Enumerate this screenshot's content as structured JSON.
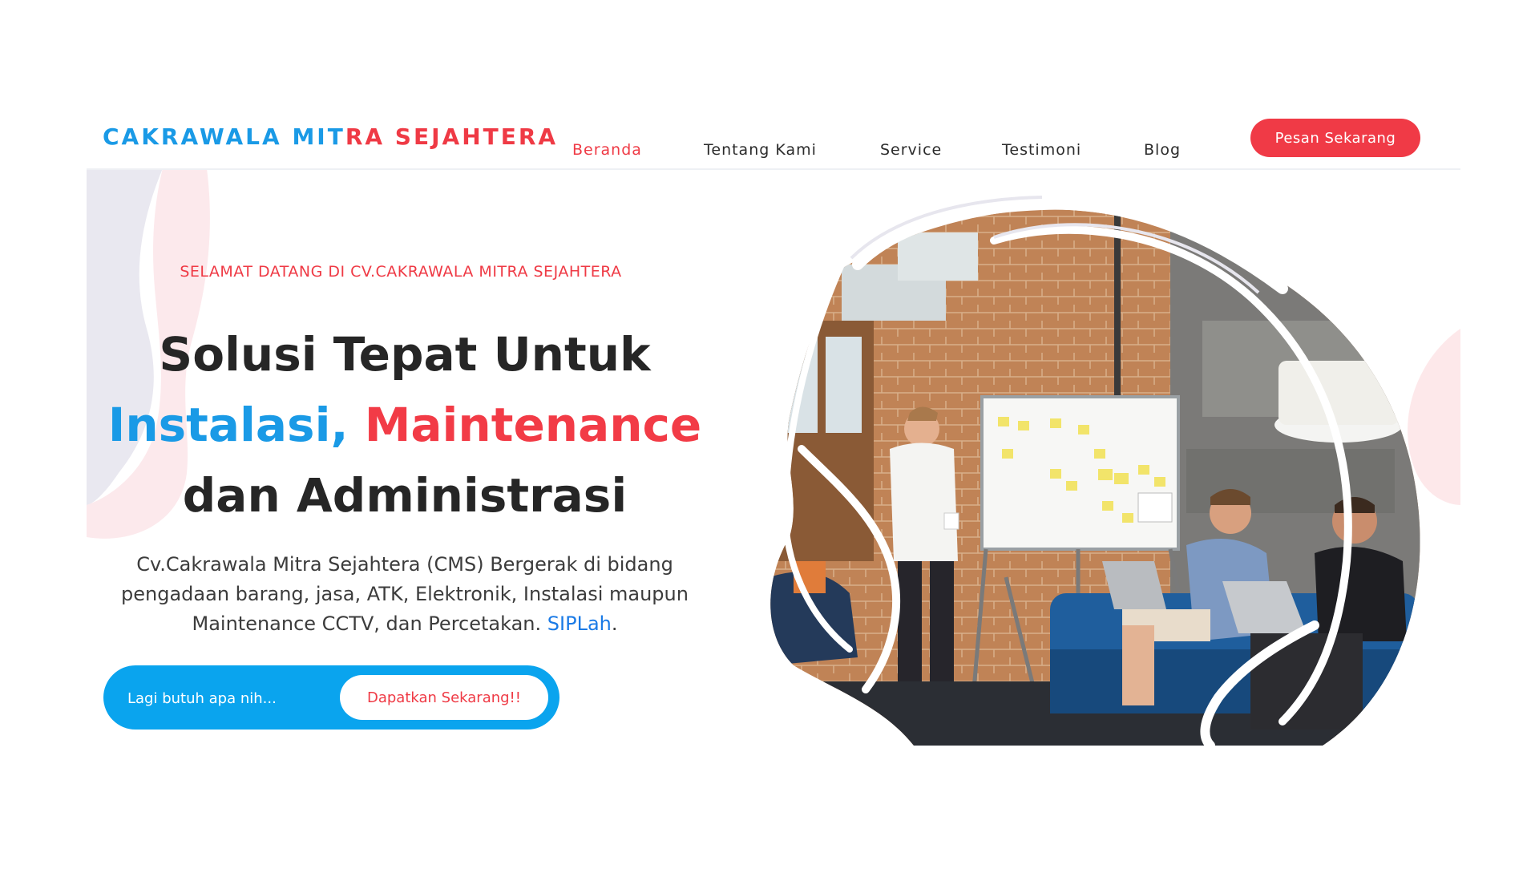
{
  "brand": {
    "logo_part1": "CAKRAWALA MIT",
    "logo_part2": "RA SEJAHTERA"
  },
  "nav": {
    "items": [
      {
        "label": "Beranda",
        "active": true
      },
      {
        "label": "Tentang Kami",
        "active": false
      },
      {
        "label": "Service",
        "active": false
      },
      {
        "label": "Testimoni",
        "active": false
      },
      {
        "label": "Blog",
        "active": false
      }
    ],
    "cta_label": "Pesan Sekarang"
  },
  "hero": {
    "welcome": "SELAMAT DATANG DI CV.CAKRAWALA MITRA SEJAHTERA",
    "headline_line1": "Solusi Tepat Untuk",
    "headline_blue": "Instalasi,",
    "headline_red": "Maintenance",
    "headline_line3": "dan Administrasi",
    "description": "Cv.Cakrawala Mitra Sejahtera (CMS) Bergerak di bidang pengadaan barang, jasa, ATK, Elektronik, Instalasi maupun Maintenance CCTV, dan Percetakan.",
    "description_link": "SIPLah",
    "description_end": "."
  },
  "search": {
    "placeholder": "Lagi butuh apa nih...",
    "button_label": "Dapatkan Sekarang!!"
  },
  "colors": {
    "brand_blue": "#1a9ae6",
    "brand_red": "#ef3a45",
    "cta_red": "#f03a46",
    "search_blue": "#0aa4ee"
  }
}
